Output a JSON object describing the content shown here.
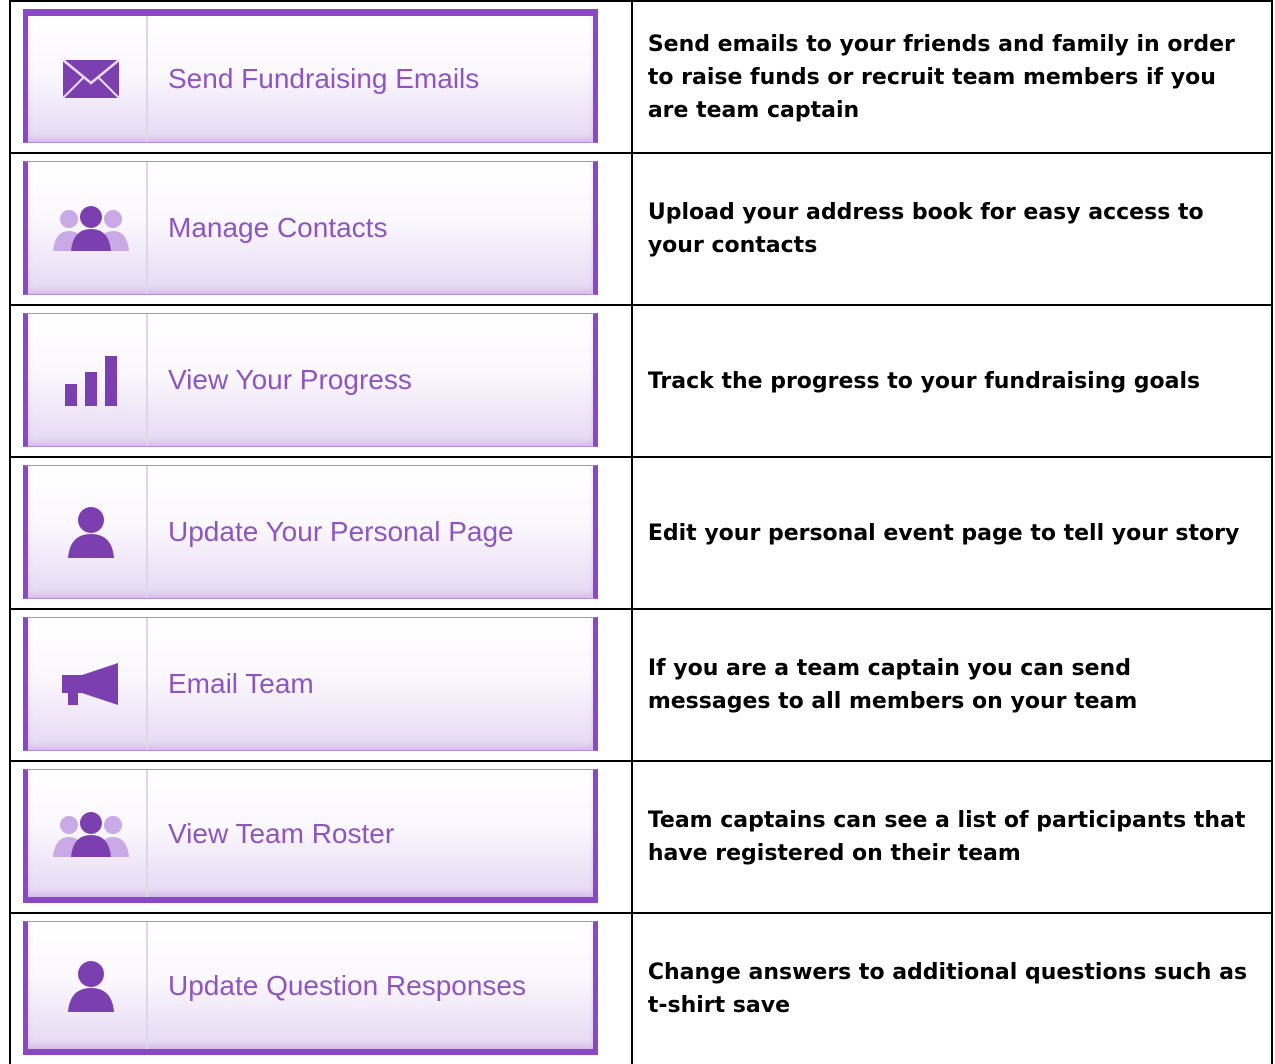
{
  "rows": [
    {
      "label": "Send Fundraising Emails",
      "icon": "envelope-icon",
      "description": "Send emails to your friends and family in order to raise funds or recruit team members if you are team captain"
    },
    {
      "label": "Manage Contacts",
      "icon": "contacts-icon",
      "description": "Upload your address book for easy access to your contacts"
    },
    {
      "label": "View Your Progress",
      "icon": "bar-chart-icon",
      "description": "Track the progress to your fundraising goals"
    },
    {
      "label": "Update Your Personal Page",
      "icon": "person-icon",
      "description": "Edit your personal event page to tell your story"
    },
    {
      "label": "Email Team",
      "icon": "megaphone-icon",
      "description": "If you are a team captain you can send messages to all members on your team"
    },
    {
      "label": "View Team Roster",
      "icon": "contacts-icon",
      "description": "Team captains can see a list of participants that have registered on their team"
    },
    {
      "label": "Update Question Responses",
      "icon": "person-icon",
      "description": "Change answers to additional questions such as t-shirt save"
    }
  ],
  "colors": {
    "accent": "#8a48c4",
    "label_text": "#8e55c2",
    "icon": "#7b3fb0"
  }
}
